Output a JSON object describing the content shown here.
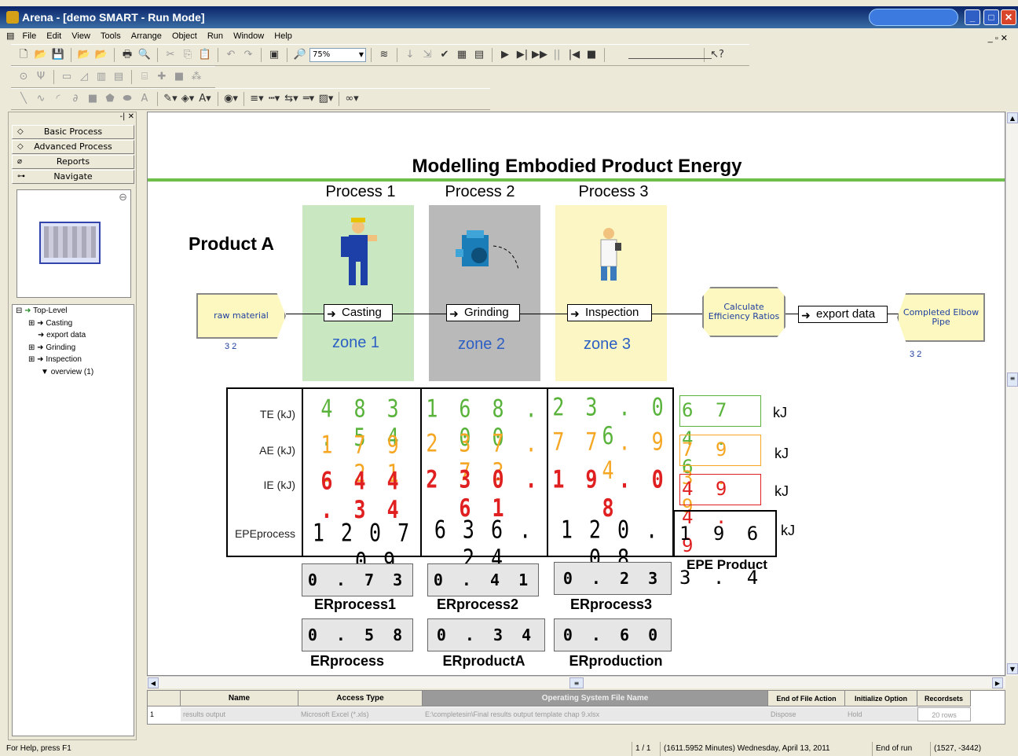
{
  "window": {
    "title": "Arena - [demo SMART - Run Mode]"
  },
  "menu": [
    "File",
    "Edit",
    "View",
    "Tools",
    "Arrange",
    "Object",
    "Run",
    "Window",
    "Help"
  ],
  "toolbar": {
    "zoom": "75%"
  },
  "panel": {
    "buttons": [
      "Basic Process",
      "Advanced Process",
      "Reports",
      "Navigate"
    ],
    "tree": [
      "Top-Level",
      "Casting",
      "export data",
      "Grinding",
      "Inspection",
      "overview (1)"
    ]
  },
  "model": {
    "title": "Modelling Embodied Product Energy",
    "product": "Product A",
    "processes": [
      {
        "title": "Process 1",
        "module": "Casting",
        "zone": "zone 1",
        "color": "#c9e8c1"
      },
      {
        "title": "Process 2",
        "module": "Grinding",
        "zone": "zone 2",
        "color": "#b9b9b9"
      },
      {
        "title": "Process 3",
        "module": "Inspection",
        "zone": "zone 3",
        "color": "#fbf6c3"
      }
    ],
    "create": {
      "label": "raw material",
      "count": "3 2"
    },
    "calc": {
      "label": "Calculate Efficiency Ratios"
    },
    "export": {
      "label": "export data"
    },
    "dispose": {
      "label": "Completed Elbow Pipe",
      "count": "3 2"
    },
    "rows": [
      {
        "label": "TE (kJ)",
        "color": "#59b33b",
        "values": [
          "4 8 3 . 5 4",
          "1 6 8 . 0 0",
          "2 3 . 0 6"
        ],
        "total": "6 7 4 . 6"
      },
      {
        "label": "AE (kJ)",
        "color": "#f5a623",
        "values": [
          "1 7 9 . 2 1",
          "2 3 7 . 7 3",
          "7 7 . 9 4"
        ],
        "total": "7 9 3 . 9"
      },
      {
        "label": "IE (kJ)",
        "color": "#e02020",
        "values": [
          "6 4 4 . 3 4",
          "2 3 0 . 6 1",
          "1 9 . 0 8"
        ],
        "total": "4 9 4 . 9"
      },
      {
        "label": "EPEprocess",
        "color": "#000000",
        "values": [
          "1 2 0 7 . 0 9",
          "6 3 6 . 2 4",
          "1 2 0 . 0 8"
        ],
        "total": "1 9 6 3 . 4"
      }
    ],
    "unit": "kJ",
    "epe_label": "EPE Product",
    "er_top": [
      {
        "value": "0 . 7 3",
        "label": "ERprocess1"
      },
      {
        "value": "0 . 4 1",
        "label": "ERprocess2"
      },
      {
        "value": "0 . 2 3",
        "label": "ERprocess3"
      }
    ],
    "er_bottom": [
      {
        "value": "0 . 5 8",
        "label": "ERprocess"
      },
      {
        "value": "0 . 3 4",
        "label": "ERproductA"
      },
      {
        "value": "0 . 6 0",
        "label": "ERproduction"
      }
    ]
  },
  "sheet": {
    "headers": [
      "Name",
      "Access Type",
      "Operating System File Name",
      "End of File Action",
      "Initialize Option",
      "Recordsets"
    ],
    "row": [
      "1",
      "results output",
      "Microsoft Excel (*.xls)",
      "E:\\completesin\\Final results output template chap 9.xlsx",
      "Dispose",
      "Hold",
      "20 rows"
    ]
  },
  "status": {
    "help": "For Help, press F1",
    "rep": "1 / 1",
    "time": "(1611.5952 Minutes) Wednesday, April 13, 2011",
    "state": "End of run",
    "coords": "(1527, -3442)"
  }
}
